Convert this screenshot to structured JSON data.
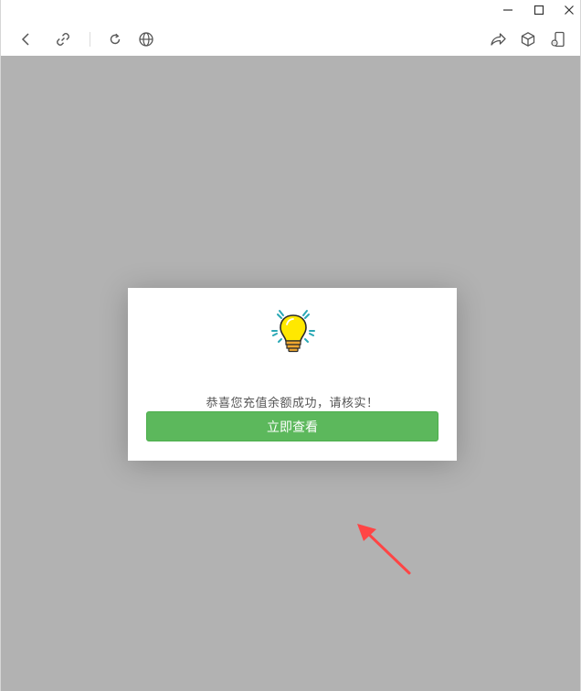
{
  "window": {
    "controls": [
      "minimize-icon",
      "maximize-icon",
      "close-icon"
    ]
  },
  "toolbar": {
    "icons": [
      "back-icon",
      "link-icon",
      "refresh-icon",
      "globe-icon",
      "share-icon",
      "cube-icon",
      "phone-icon"
    ]
  },
  "dialog": {
    "icon": "lightbulb-icon",
    "message": "恭喜您充值余额成功，请核实！",
    "button_label": "立即查看",
    "button_color": "#5cb85c"
  },
  "annotation": {
    "icon": "arrow-icon",
    "color": "#ff4545"
  },
  "colors": {
    "overlay": "#b2b2b2",
    "dialog_background": "#ffffff",
    "message_text": "#555555"
  }
}
